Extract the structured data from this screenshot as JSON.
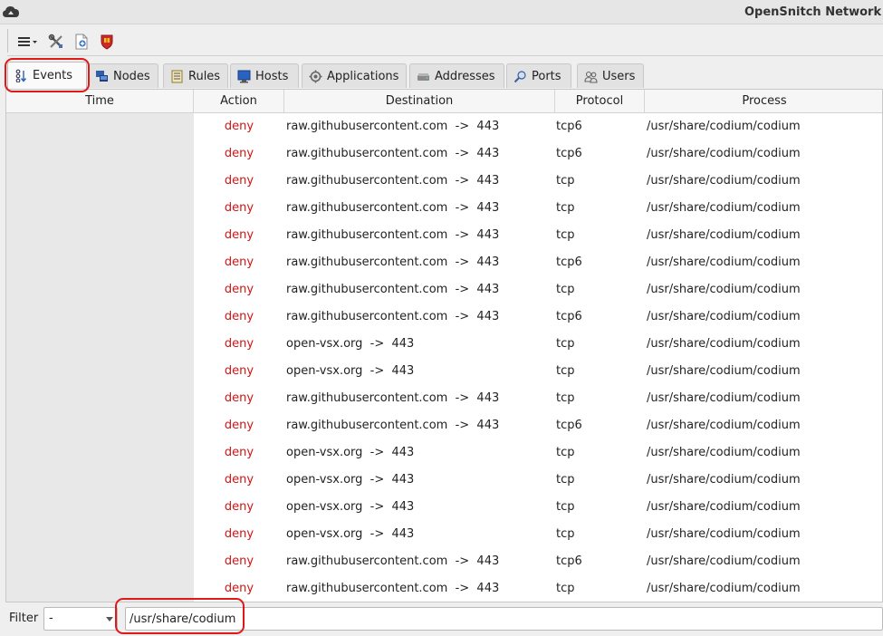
{
  "window": {
    "title": "OpenSnitch Network Stat"
  },
  "toolbar": {
    "buttons": [
      {
        "name": "menu-button",
        "icon": "hamburger-menu-icon"
      },
      {
        "name": "preferences-button",
        "icon": "tools-icon"
      },
      {
        "name": "new-rule-button",
        "icon": "new-document-icon"
      },
      {
        "name": "firewall-button",
        "icon": "shield-icon"
      }
    ]
  },
  "tabs": [
    {
      "label": "Events",
      "icon": "events-icon",
      "active": true
    },
    {
      "label": "Nodes",
      "icon": "nodes-icon"
    },
    {
      "label": "Rules",
      "icon": "rules-icon"
    },
    {
      "label": "Hosts",
      "icon": "hosts-icon"
    },
    {
      "label": "Applications",
      "icon": "applications-icon"
    },
    {
      "label": "Addresses",
      "icon": "addresses-icon"
    },
    {
      "label": "Ports",
      "icon": "ports-icon"
    },
    {
      "label": "Users",
      "icon": "users-icon"
    }
  ],
  "table": {
    "columns": [
      "Time",
      "Action",
      "Destination",
      "Protocol",
      "Process"
    ],
    "rows": [
      {
        "time": "",
        "action": "deny",
        "destination": "raw.githubusercontent.com  ->  443",
        "protocol": "tcp6",
        "process": "/usr/share/codium/codium"
      },
      {
        "time": "",
        "action": "deny",
        "destination": "raw.githubusercontent.com  ->  443",
        "protocol": "tcp6",
        "process": "/usr/share/codium/codium"
      },
      {
        "time": "",
        "action": "deny",
        "destination": "raw.githubusercontent.com  ->  443",
        "protocol": "tcp",
        "process": "/usr/share/codium/codium"
      },
      {
        "time": "",
        "action": "deny",
        "destination": "raw.githubusercontent.com  ->  443",
        "protocol": "tcp",
        "process": "/usr/share/codium/codium"
      },
      {
        "time": "",
        "action": "deny",
        "destination": "raw.githubusercontent.com  ->  443",
        "protocol": "tcp",
        "process": "/usr/share/codium/codium"
      },
      {
        "time": "",
        "action": "deny",
        "destination": "raw.githubusercontent.com  ->  443",
        "protocol": "tcp6",
        "process": "/usr/share/codium/codium"
      },
      {
        "time": "",
        "action": "deny",
        "destination": "raw.githubusercontent.com  ->  443",
        "protocol": "tcp",
        "process": "/usr/share/codium/codium"
      },
      {
        "time": "",
        "action": "deny",
        "destination": "raw.githubusercontent.com  ->  443",
        "protocol": "tcp6",
        "process": "/usr/share/codium/codium"
      },
      {
        "time": "",
        "action": "deny",
        "destination": "open-vsx.org  ->  443",
        "protocol": "tcp",
        "process": "/usr/share/codium/codium"
      },
      {
        "time": "",
        "action": "deny",
        "destination": "open-vsx.org  ->  443",
        "protocol": "tcp",
        "process": "/usr/share/codium/codium"
      },
      {
        "time": "",
        "action": "deny",
        "destination": "raw.githubusercontent.com  ->  443",
        "protocol": "tcp",
        "process": "/usr/share/codium/codium"
      },
      {
        "time": "",
        "action": "deny",
        "destination": "raw.githubusercontent.com  ->  443",
        "protocol": "tcp6",
        "process": "/usr/share/codium/codium"
      },
      {
        "time": "",
        "action": "deny",
        "destination": "open-vsx.org  ->  443",
        "protocol": "tcp",
        "process": "/usr/share/codium/codium"
      },
      {
        "time": "",
        "action": "deny",
        "destination": "open-vsx.org  ->  443",
        "protocol": "tcp",
        "process": "/usr/share/codium/codium"
      },
      {
        "time": "",
        "action": "deny",
        "destination": "open-vsx.org  ->  443",
        "protocol": "tcp",
        "process": "/usr/share/codium/codium"
      },
      {
        "time": "",
        "action": "deny",
        "destination": "open-vsx.org  ->  443",
        "protocol": "tcp",
        "process": "/usr/share/codium/codium"
      },
      {
        "time": "",
        "action": "deny",
        "destination": "raw.githubusercontent.com  ->  443",
        "protocol": "tcp6",
        "process": "/usr/share/codium/codium"
      },
      {
        "time": "",
        "action": "deny",
        "destination": "raw.githubusercontent.com  ->  443",
        "protocol": "tcp",
        "process": "/usr/share/codium/codium"
      }
    ]
  },
  "filter": {
    "label": "Filter",
    "combo_value": "-",
    "text_value": "/usr/share/codium"
  },
  "colors": {
    "deny": "#d21414",
    "annotation": "#e01818"
  }
}
